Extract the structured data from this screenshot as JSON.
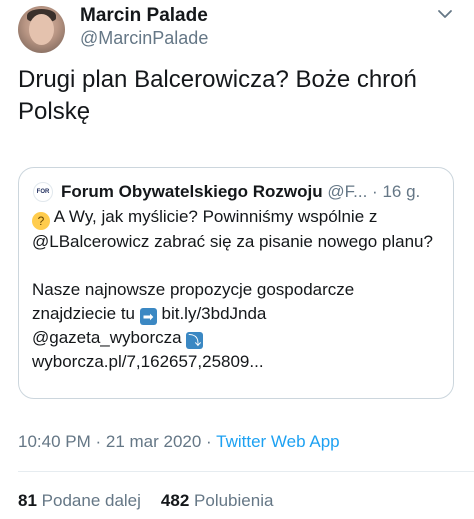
{
  "author": {
    "name": "Marcin Palade",
    "handle": "@MarcinPalade"
  },
  "tweet": {
    "text": "Drugi plan Balcerowicza? Boże chroń Polskę"
  },
  "quoted": {
    "logo_text": "FOR",
    "name": "Forum Obywatelskiego Rozwoju",
    "handle": "@F...",
    "dot": "·",
    "time": "16 g.",
    "line1": "A Wy, jak myślicie? Powinniśmy wspólnie z @LBalcerowicz zabrać się za pisanie nowego planu?",
    "line2_before": "Nasze najnowsze propozycje gospodarcze znajdziecie tu",
    "link1": "bit.ly/3bdJnda",
    "mention": "@gazeta_wyborcza",
    "link2": "wyborcza.pl/7,162657,25809...",
    "emoji_think": "thinking-face",
    "emoji_arrow_right": "➡",
    "emoji_arrow_down": "⤵"
  },
  "meta": {
    "time": "10:40 PM · 21 mar 2020 ·",
    "app": "Twitter Web App"
  },
  "stats": {
    "retweets_count": "81",
    "retweets_label": "Podane dalej",
    "likes_count": "482",
    "likes_label": "Polubienia"
  },
  "colors": {
    "link": "#1da1f2",
    "secondary": "#657786",
    "text": "#14171a",
    "border": "#ccd6dd"
  }
}
